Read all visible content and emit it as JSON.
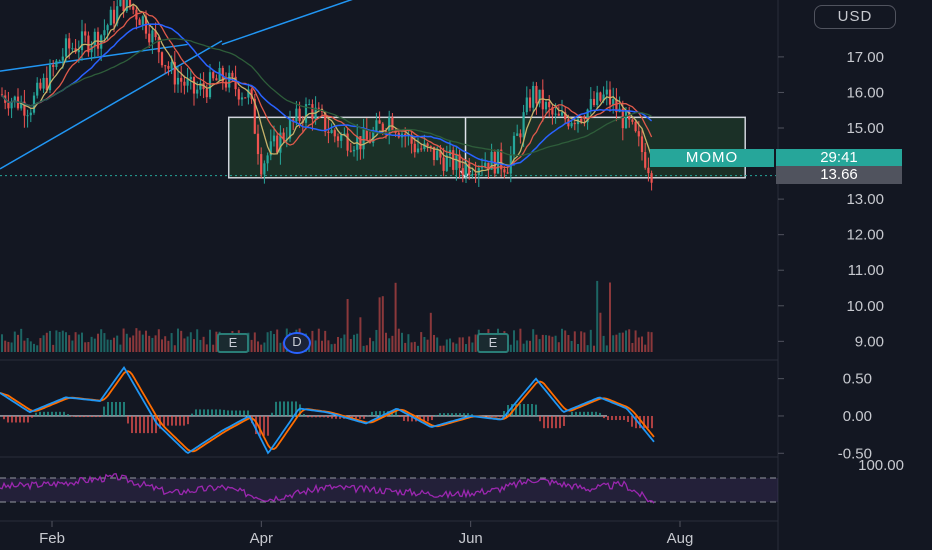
{
  "currency_button": "USD",
  "ticker_label": "MOMO",
  "countdown": "29:41",
  "last_price_label": "13.66",
  "events": [
    {
      "label": "E",
      "type": "earnings"
    },
    {
      "label": "D",
      "type": "dividend"
    },
    {
      "label": "E",
      "type": "earnings"
    }
  ],
  "colors": {
    "background": "#131722",
    "up": "#26a69a",
    "down": "#ef5350",
    "rect_fill": "#1f3a2a",
    "macd": "#2196f3",
    "signal": "#ff6d00",
    "rsi": "#9c27b0",
    "trendline": "#2196f3"
  },
  "chart_data": [
    {
      "type": "candlestick",
      "x_ticks": [
        "Feb",
        "Apr",
        "Jun",
        "Aug"
      ],
      "y_ticks": [
        "17.00",
        "16.00",
        "15.00",
        "14.00",
        "13.00",
        "12.00",
        "11.00",
        "10.00",
        "9.00"
      ],
      "ylim": [
        8.7,
        18.6
      ],
      "last_price": 13.66,
      "range_box": {
        "high": 15.3,
        "low": 13.6
      },
      "moving_averages": [
        "short",
        "medium",
        "long",
        "longest"
      ],
      "price_path": [
        {
          "x": "Jan-15",
          "y": 16.0
        },
        {
          "x": "Jan-25",
          "y": 15.6
        },
        {
          "x": "Feb-05",
          "y": 17.2
        },
        {
          "x": "Feb-15",
          "y": 17.6
        },
        {
          "x": "Feb-22",
          "y": 18.6
        },
        {
          "x": "Feb-28",
          "y": 18.0
        },
        {
          "x": "Mar-05",
          "y": 16.6
        },
        {
          "x": "Mar-12",
          "y": 16.0
        },
        {
          "x": "Mar-20",
          "y": 16.4
        },
        {
          "x": "Mar-28",
          "y": 15.9
        },
        {
          "x": "Apr-01",
          "y": 14.0
        },
        {
          "x": "Apr-08",
          "y": 14.9
        },
        {
          "x": "Apr-15",
          "y": 15.6
        },
        {
          "x": "Apr-22",
          "y": 14.8
        },
        {
          "x": "May-01",
          "y": 14.6
        },
        {
          "x": "May-08",
          "y": 15.3
        },
        {
          "x": "May-15",
          "y": 14.5
        },
        {
          "x": "May-22",
          "y": 14.2
        },
        {
          "x": "May-29",
          "y": 13.9
        },
        {
          "x": "Jun-05",
          "y": 14.1
        },
        {
          "x": "Jun-12",
          "y": 14.0
        },
        {
          "x": "Jun-19",
          "y": 16.0
        },
        {
          "x": "Jun-26",
          "y": 15.2
        },
        {
          "x": "Jul-03",
          "y": 15.4
        },
        {
          "x": "Jul-10",
          "y": 15.9
        },
        {
          "x": "Jul-17",
          "y": 15.0
        },
        {
          "x": "Jul-24",
          "y": 13.66
        }
      ]
    },
    {
      "type": "bar",
      "name": "volume",
      "description_levels": "relative"
    },
    {
      "type": "line",
      "name": "MACD",
      "y_ticks": [
        "0.50",
        "0.00",
        "-0.50"
      ],
      "ylim": [
        -0.55,
        0.75
      ],
      "macd": [
        {
          "x": "Jan-15",
          "y": 0.35
        },
        {
          "x": "Jan-25",
          "y": 0.05
        },
        {
          "x": "Feb-05",
          "y": 0.25
        },
        {
          "x": "Feb-15",
          "y": 0.2
        },
        {
          "x": "Feb-22",
          "y": 0.65
        },
        {
          "x": "Mar-01",
          "y": -0.1
        },
        {
          "x": "Mar-10",
          "y": -0.5
        },
        {
          "x": "Mar-20",
          "y": -0.2
        },
        {
          "x": "Mar-28",
          "y": 0.0
        },
        {
          "x": "Apr-03",
          "y": -0.5
        },
        {
          "x": "Apr-12",
          "y": 0.1
        },
        {
          "x": "Apr-20",
          "y": 0.05
        },
        {
          "x": "May-01",
          "y": -0.1
        },
        {
          "x": "May-10",
          "y": 0.1
        },
        {
          "x": "May-20",
          "y": -0.15
        },
        {
          "x": "Jun-01",
          "y": 0.0
        },
        {
          "x": "Jun-10",
          "y": -0.05
        },
        {
          "x": "Jun-20",
          "y": 0.5
        },
        {
          "x": "Jun-28",
          "y": 0.05
        },
        {
          "x": "Jul-08",
          "y": 0.25
        },
        {
          "x": "Jul-16",
          "y": 0.1
        },
        {
          "x": "Jul-24",
          "y": -0.35
        }
      ]
    },
    {
      "type": "line",
      "name": "RSI",
      "y_ticks": [
        "100.00"
      ],
      "ylim": [
        0,
        100
      ],
      "bands": [
        70,
        30
      ],
      "rsi": [
        {
          "x": "Jan-15",
          "y": 55
        },
        {
          "x": "Feb-01",
          "y": 60
        },
        {
          "x": "Feb-20",
          "y": 72
        },
        {
          "x": "Mar-05",
          "y": 45
        },
        {
          "x": "Mar-20",
          "y": 55
        },
        {
          "x": "Apr-03",
          "y": 35
        },
        {
          "x": "Apr-20",
          "y": 55
        },
        {
          "x": "May-10",
          "y": 48
        },
        {
          "x": "May-25",
          "y": 42
        },
        {
          "x": "Jun-08",
          "y": 50
        },
        {
          "x": "Jun-20",
          "y": 68
        },
        {
          "x": "Jul-05",
          "y": 52
        },
        {
          "x": "Jul-15",
          "y": 60
        },
        {
          "x": "Jul-24",
          "y": 28
        }
      ]
    }
  ]
}
